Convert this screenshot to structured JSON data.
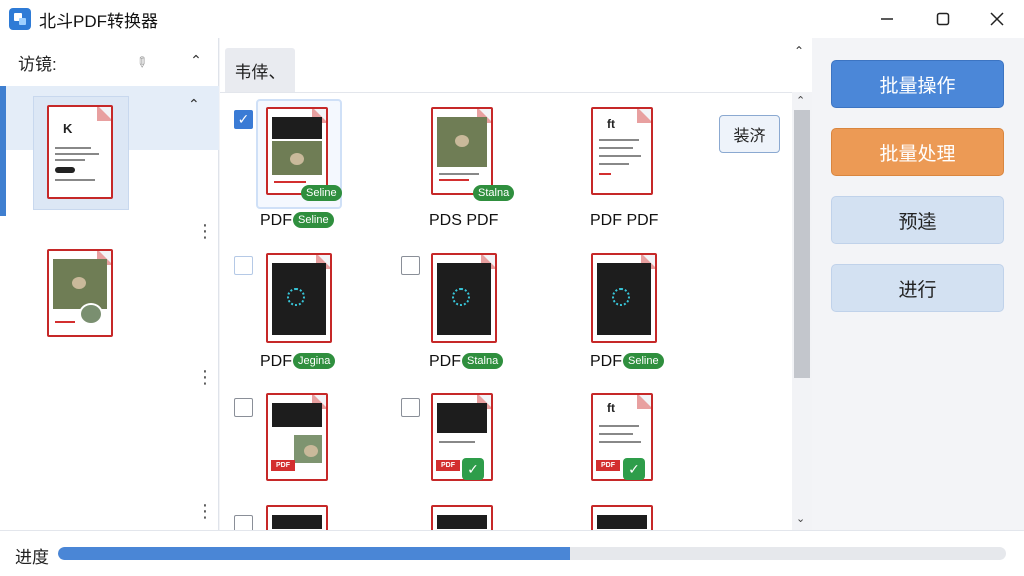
{
  "window": {
    "title": "北斗PDF转换器",
    "minimize_icon": "minimize-icon",
    "maximize_icon": "maximize-icon",
    "close_icon": "close-icon"
  },
  "sidebar": {
    "title": "访镜:"
  },
  "main": {
    "tab_label": "韦倖、",
    "sort_button": "装济",
    "files": [
      {
        "label": "PDF",
        "badge": "Seline",
        "checked": true
      },
      {
        "label": "PDS PDF",
        "badge": "Stalna",
        "checked": false
      },
      {
        "label": "PDF PDF",
        "badge": "",
        "checked": false
      },
      {
        "label": "PDF",
        "badge": "Jegina",
        "checked": false
      },
      {
        "label": "PDF",
        "badge": "Stalna",
        "checked": false
      },
      {
        "label": "PDF",
        "badge": "Seline",
        "checked": false
      },
      {
        "label": "",
        "badge": "",
        "checked": false
      },
      {
        "label": "",
        "badge": "",
        "checked": false
      },
      {
        "label": "",
        "badge": "",
        "checked": false
      }
    ],
    "thumb_pdf_tag": "PDF"
  },
  "actions": {
    "batch_operation": "批量操作",
    "batch_process": "批量处理",
    "preview": "预逵",
    "run": "进行"
  },
  "progress": {
    "label": "进度",
    "value": 0.54
  }
}
